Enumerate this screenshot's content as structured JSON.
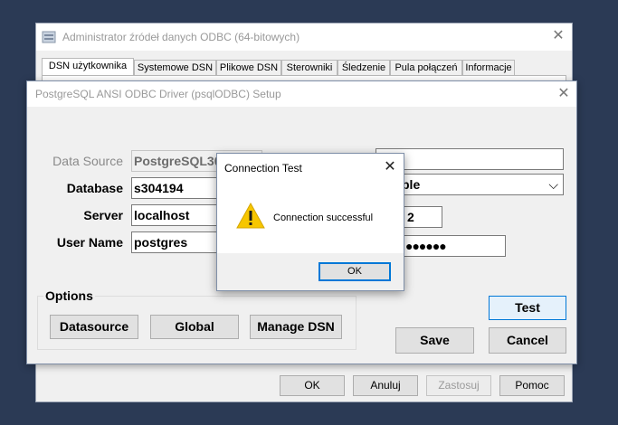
{
  "admin_window": {
    "title": "Administrator źródeł danych ODBC (64-bitowych)",
    "close_glyph": "✕",
    "tabs": [
      "DSN użytkownika",
      "Systemowe DSN",
      "Plikowe DSN",
      "Sterowniki",
      "Śledzenie",
      "Pula połączeń",
      "Informacje"
    ],
    "buttons": {
      "ok": "OK",
      "cancel": "Anuluj",
      "apply": "Zastosuj",
      "help": "Pomoc"
    }
  },
  "setup_window": {
    "title": "PostgreSQL ANSI ODBC Driver (psqlODBC) Setup",
    "close_glyph": "✕",
    "fields": {
      "data_source": {
        "label": "Data Source",
        "value": "PostgreSQL30"
      },
      "database": {
        "label": "Database",
        "value": "s304194"
      },
      "server": {
        "label": "Server",
        "value": "localhost"
      },
      "user_name": {
        "label": "User Name",
        "value": "postgres"
      }
    },
    "right_column": {
      "ssl_mode_value": "ble",
      "port_value": "2",
      "password_mask": "●●●●●●",
      "dropdown_arrow": "⌵"
    },
    "options": {
      "label": "Options",
      "datasource_button": "Datasource",
      "global_button": "Global",
      "manage_dsn_button": "Manage DSN"
    },
    "test_button": "Test",
    "save_button": "Save",
    "cancel_button": "Cancel"
  },
  "test_dialog": {
    "title": "Connection Test",
    "close_glyph": "✕",
    "message": "Connection successful",
    "icon": "warning-icon",
    "ok_button": "OK"
  },
  "colors": {
    "desktop": "#2b3a55",
    "focus_blue": "#0078d7",
    "warning_yellow": "#f7c600"
  }
}
